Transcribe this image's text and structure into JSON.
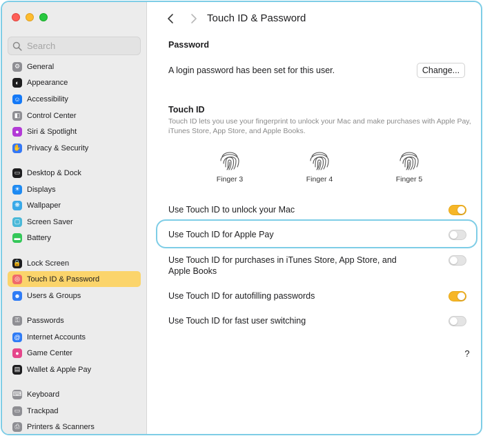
{
  "search": {
    "placeholder": "Search"
  },
  "sidebar": {
    "items": [
      {
        "label": "General",
        "icon": "gear-icon",
        "color": "#8e8e93"
      },
      {
        "label": "Appearance",
        "icon": "appearance-icon",
        "color": "#1d1d1f"
      },
      {
        "label": "Accessibility",
        "icon": "accessibility-icon",
        "color": "#1479f7"
      },
      {
        "label": "Control Center",
        "icon": "control-center-icon",
        "color": "#8e8e93"
      },
      {
        "label": "Siri & Spotlight",
        "icon": "siri-icon",
        "color": "#b23ad6"
      },
      {
        "label": "Privacy & Security",
        "icon": "hand-icon",
        "color": "#3478f6"
      },
      {
        "label": "Desktop & Dock",
        "icon": "dock-icon",
        "color": "#1d1d1f"
      },
      {
        "label": "Displays",
        "icon": "displays-icon",
        "color": "#1e8af2"
      },
      {
        "label": "Wallpaper",
        "icon": "wallpaper-icon",
        "color": "#39a9e8"
      },
      {
        "label": "Screen Saver",
        "icon": "screen-saver-icon",
        "color": "#49b8d8"
      },
      {
        "label": "Battery",
        "icon": "battery-icon",
        "color": "#34c759"
      },
      {
        "label": "Lock Screen",
        "icon": "lock-icon",
        "color": "#1d1d1f"
      },
      {
        "label": "Touch ID & Password",
        "icon": "fingerprint-icon",
        "color": "#f06a6a"
      },
      {
        "label": "Users & Groups",
        "icon": "users-icon",
        "color": "#2f7cf6"
      },
      {
        "label": "Passwords",
        "icon": "key-icon",
        "color": "#8e8e93"
      },
      {
        "label": "Internet Accounts",
        "icon": "at-icon",
        "color": "#2f7cf6"
      },
      {
        "label": "Game Center",
        "icon": "game-center-icon",
        "color": "#e5468b"
      },
      {
        "label": "Wallet & Apple Pay",
        "icon": "wallet-icon",
        "color": "#1d1d1f"
      },
      {
        "label": "Keyboard",
        "icon": "keyboard-icon",
        "color": "#8e8e93"
      },
      {
        "label": "Trackpad",
        "icon": "trackpad-icon",
        "color": "#8e8e93"
      },
      {
        "label": "Printers & Scanners",
        "icon": "printer-icon",
        "color": "#8e8e93"
      }
    ],
    "selected": "Touch ID & Password"
  },
  "header": {
    "title": "Touch ID & Password"
  },
  "password": {
    "section_title": "Password",
    "status": "A login password has been set for this user.",
    "change_label": "Change..."
  },
  "touchid": {
    "section_title": "Touch ID",
    "description": "Touch ID lets you use your fingerprint to unlock your Mac and make purchases with Apple Pay, iTunes Store, App Store, and Apple Books.",
    "fingers": [
      {
        "label": "Finger 3"
      },
      {
        "label": "Finger 4"
      },
      {
        "label": "Finger 5"
      }
    ]
  },
  "options": [
    {
      "label": "Use Touch ID to unlock your Mac",
      "on": true
    },
    {
      "label": "Use Touch ID for Apple Pay",
      "on": false
    },
    {
      "label": "Use Touch ID for purchases in iTunes Store, App Store, and Apple Books",
      "on": false
    },
    {
      "label": "Use Touch ID for autofilling passwords",
      "on": true
    },
    {
      "label": "Use Touch ID for fast user switching",
      "on": false
    }
  ],
  "help": {
    "label": "?"
  },
  "colors": {
    "accent": "#f6b628",
    "selection": "#fbd46b",
    "highlight_ring": "#7ecde6"
  }
}
